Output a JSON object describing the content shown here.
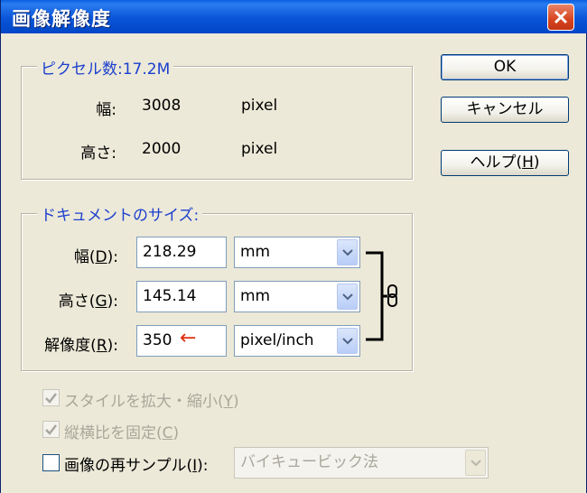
{
  "window": {
    "title": "画像解像度"
  },
  "pixel_dimensions": {
    "legend": "ピクセル数:17.2M",
    "width": {
      "label": "幅:",
      "value": "3008",
      "unit": "pixel"
    },
    "height": {
      "label": "高さ:",
      "value": "2000",
      "unit": "pixel"
    }
  },
  "document_size": {
    "legend": "ドキュメントのサイズ:",
    "width": {
      "label_pre": "幅(",
      "key": "D",
      "label_post": "):",
      "value": "218.29",
      "unit": "mm"
    },
    "height": {
      "label_pre": "高さ(",
      "key": "G",
      "label_post": "):",
      "value": "145.14",
      "unit": "mm"
    },
    "resolution": {
      "label_pre": "解像度(",
      "key": "R",
      "label_post": "):",
      "value": "350",
      "unit": "pixel/inch"
    },
    "annotation_arrow": "←"
  },
  "options": {
    "scale_styles": {
      "label_pre": "スタイルを拡大・縮小(",
      "key": "Y",
      "label_post": ")",
      "checked": true,
      "disabled": true
    },
    "constrain": {
      "label_pre": "縦横比を固定(",
      "key": "C",
      "label_post": ")",
      "checked": true,
      "disabled": true
    },
    "resample": {
      "label_pre": "画像の再サンプル(",
      "key": "I",
      "label_post": "):",
      "checked": false,
      "method": "バイキュービック法"
    }
  },
  "buttons": {
    "ok": "OK",
    "cancel": "キャンセル",
    "help_pre": "ヘルプ(",
    "help_key": "H",
    "help_post": ")"
  },
  "colors": {
    "titlebar": "#0a55d8",
    "legend_text": "#1c3fce",
    "arrow": "#e03010",
    "close": "#d6441f"
  }
}
